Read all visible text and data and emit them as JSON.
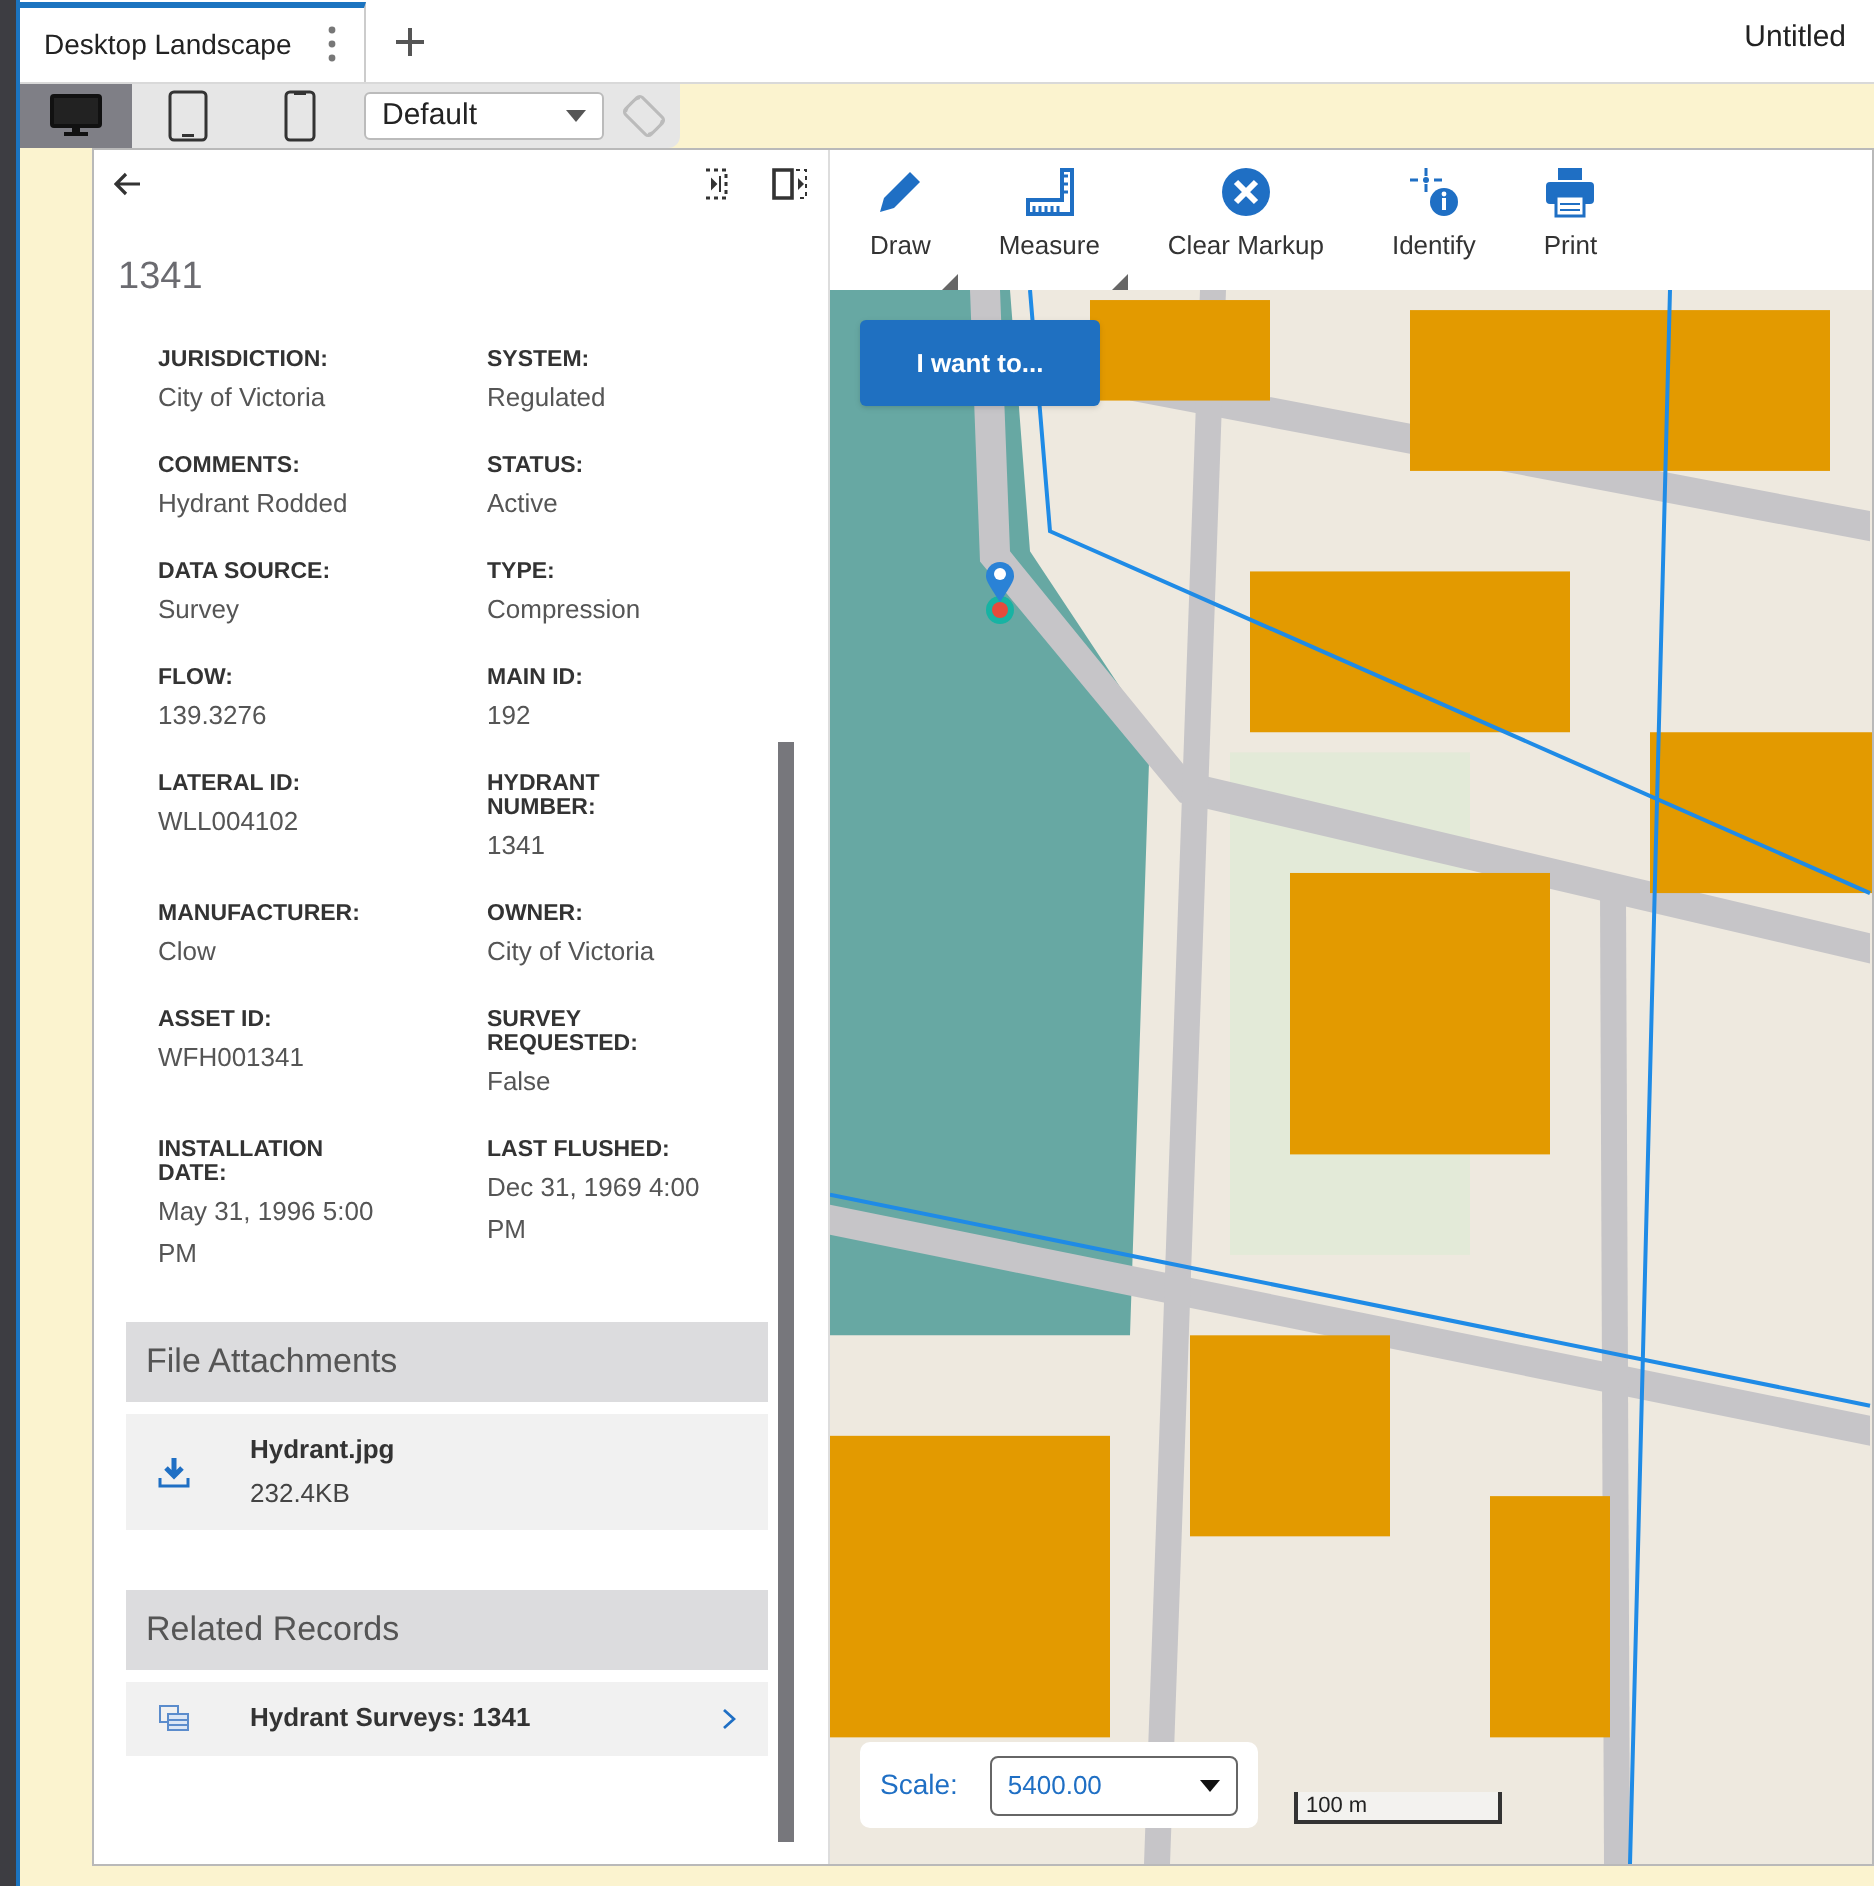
{
  "tabs": [
    {
      "label": "Desktop Landscape",
      "selected": true
    }
  ],
  "document_title": "Untitled",
  "devices": [
    {
      "kind": "desktop",
      "selected": true
    },
    {
      "kind": "tablet",
      "selected": false
    },
    {
      "kind": "phone",
      "selected": false
    }
  ],
  "layout_select": {
    "value": "Default"
  },
  "panel": {
    "title": "1341",
    "fields": [
      {
        "label": "JURISDICTION:",
        "value": "City of Victoria"
      },
      {
        "label": "SYSTEM:",
        "value": "Regulated"
      },
      {
        "label": "COMMENTS:",
        "value": "Hydrant Rodded"
      },
      {
        "label": "STATUS:",
        "value": "Active"
      },
      {
        "label": "DATA SOURCE:",
        "value": "Survey"
      },
      {
        "label": "TYPE:",
        "value": "Compression"
      },
      {
        "label": "FLOW:",
        "value": "139.3276"
      },
      {
        "label": "MAIN ID:",
        "value": "192"
      },
      {
        "label": "LATERAL ID:",
        "value": "WLL004102"
      },
      {
        "label": "HYDRANT NUMBER:",
        "value": "1341"
      },
      {
        "label": "MANUFACTURER:",
        "value": "Clow"
      },
      {
        "label": "OWNER:",
        "value": "City of Victoria"
      },
      {
        "label": "ASSET ID:",
        "value": "WFH001341"
      },
      {
        "label": "SURVEY REQUESTED:",
        "value": "False"
      },
      {
        "label": "INSTALLATION DATE:",
        "value": "May 31, 1996 5:00 PM"
      },
      {
        "label": "LAST FLUSHED:",
        "value": "Dec 31, 1969 4:00 PM"
      }
    ],
    "attachments": {
      "title": "File Attachments",
      "items": [
        {
          "name": "Hydrant.jpg",
          "size": "232.4KB"
        }
      ]
    },
    "related": {
      "title": "Related Records",
      "items": [
        {
          "label": "Hydrant Surveys: 1341"
        }
      ]
    }
  },
  "toolbar": [
    {
      "kind": "draw",
      "label": "Draw",
      "menu": true
    },
    {
      "kind": "measure",
      "label": "Measure",
      "menu": true
    },
    {
      "kind": "clear",
      "label": "Clear Markup",
      "menu": false
    },
    {
      "kind": "identify",
      "label": "Identify",
      "menu": false
    },
    {
      "kind": "print",
      "label": "Print",
      "menu": false
    }
  ],
  "i_want_to": "I want to...",
  "scale": {
    "label": "Scale:",
    "value": "5400.00"
  },
  "scale_bar": "100 m"
}
